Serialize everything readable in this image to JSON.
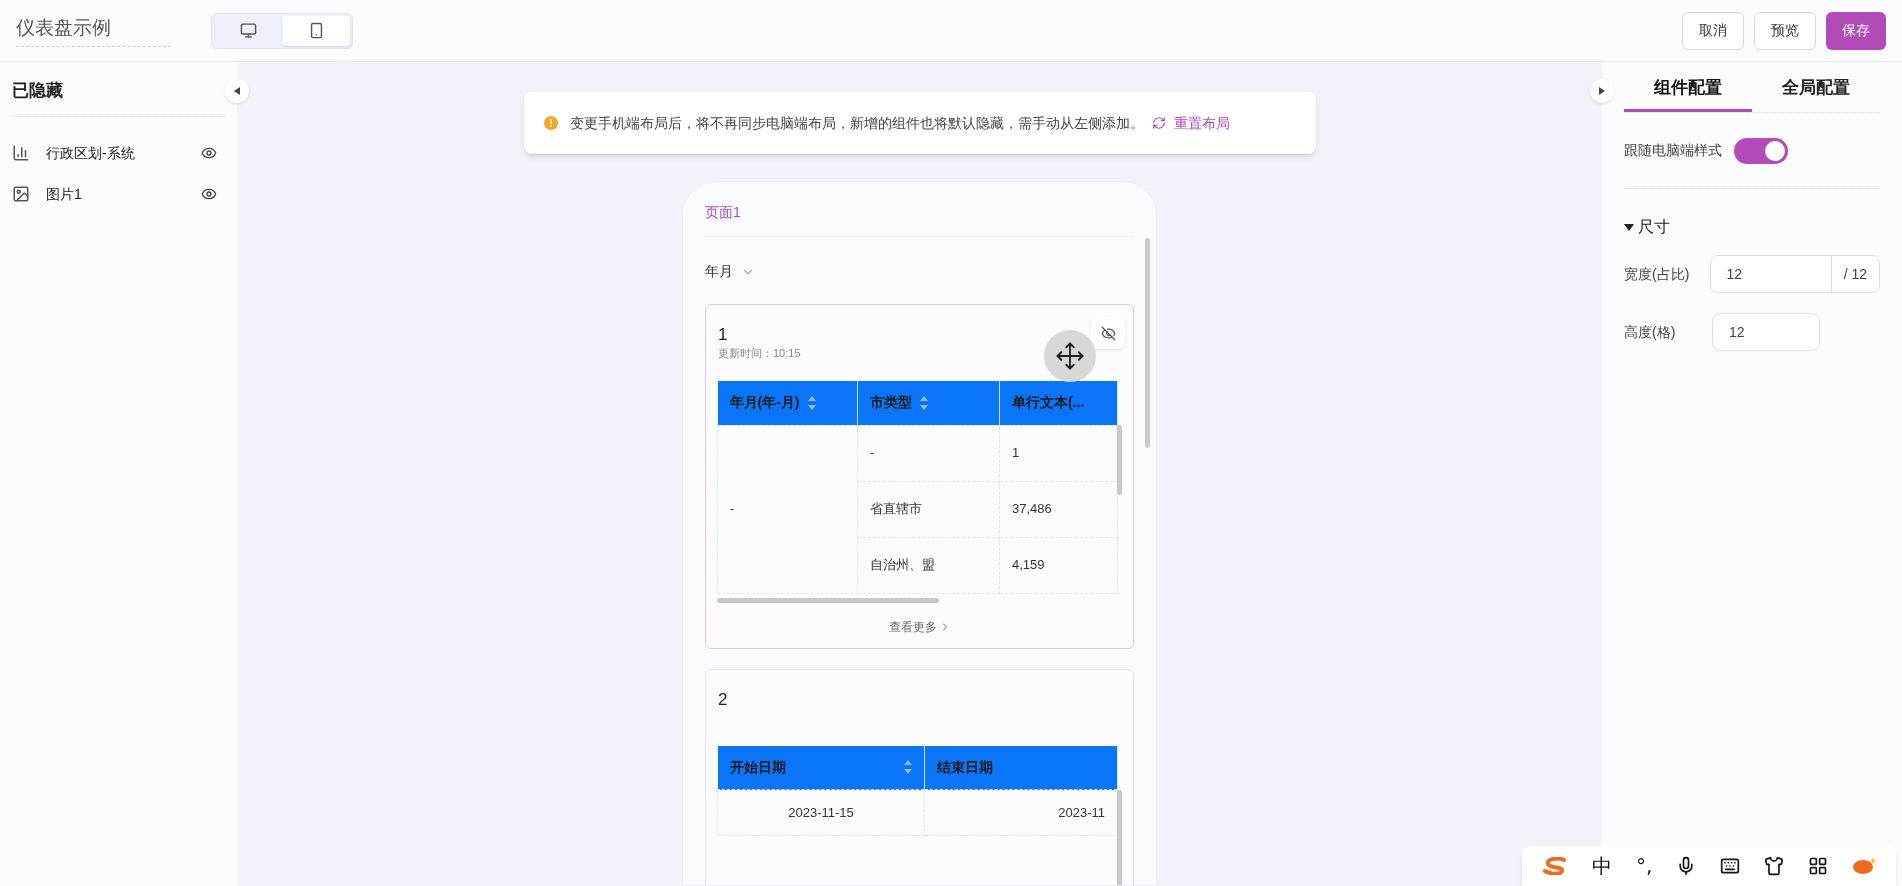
{
  "header": {
    "title": "仪表盘示例",
    "device_tabs": [
      {
        "kind": "desktop",
        "selected": false
      },
      {
        "kind": "mobile",
        "selected": true
      }
    ],
    "buttons": [
      {
        "label": "取消",
        "kind": "default"
      },
      {
        "label": "预览",
        "kind": "default"
      },
      {
        "label": "保存",
        "kind": "primary"
      }
    ]
  },
  "hidden_panel": {
    "title": "已隐藏",
    "items": [
      {
        "kind": "chart",
        "label": "行政区划-系统"
      },
      {
        "kind": "image",
        "label": "图片1"
      }
    ]
  },
  "notice": {
    "text": "变更手机端布局后，将不再同步电脑端布局，新增的组件也将默认隐藏，需手动从左侧添加。",
    "link": "重置布局"
  },
  "phone": {
    "page_tab": "页面1",
    "filter": "年月",
    "cards": [
      {
        "title": "1",
        "updated": "更新时间：10:15",
        "selected": true,
        "columns": [
          {
            "label": "年月(年-月)",
            "sortable": true
          },
          {
            "label": "市类型",
            "sortable": true
          },
          {
            "label": "单行文本(..."
          }
        ],
        "rows": [
          {
            "cells": [
              {
                "text": "-",
                "rowspan": 3
              },
              {
                "text": "-"
              },
              {
                "text": "1"
              }
            ]
          },
          {
            "cells": [
              {
                "text": "省直辖市"
              },
              {
                "text": "37,486"
              }
            ]
          },
          {
            "cells": [
              {
                "text": "自治州、盟"
              },
              {
                "text": "4,159"
              }
            ]
          }
        ],
        "more": "查看更多"
      },
      {
        "title": "2",
        "selected": false,
        "columns": [
          {
            "label": "开始日期",
            "sortable": true
          },
          {
            "label": "结束日期"
          }
        ],
        "rows": [
          {
            "cells": [
              {
                "text": "2023-11-15"
              },
              {
                "text": "2023-11"
              }
            ]
          }
        ]
      }
    ]
  },
  "config_panel": {
    "tabs": [
      {
        "label": "组件配置",
        "selected": true
      },
      {
        "label": "全局配置",
        "selected": false
      }
    ],
    "follow_desktop": {
      "label": "跟随电脑端样式",
      "on": true
    },
    "section": {
      "title": "尺寸",
      "expanded": true
    },
    "fields": [
      {
        "label": "宽度(占比)",
        "value": "12",
        "suffix": "/ 12"
      },
      {
        "label": "高度(格)",
        "value": "12"
      }
    ]
  },
  "ime_bar": {
    "items": [
      "中",
      "°,"
    ]
  }
}
